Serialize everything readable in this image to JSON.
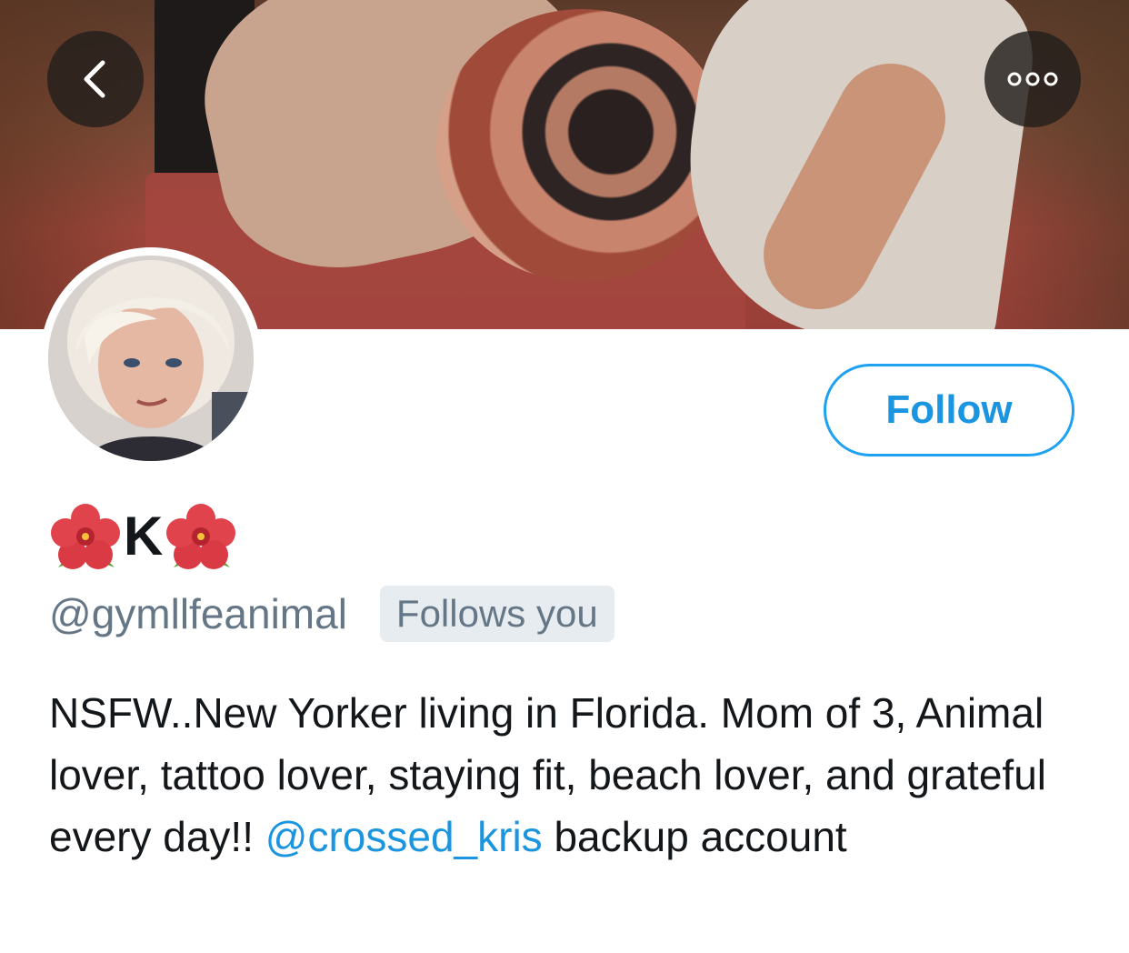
{
  "header": {
    "back_icon": "chevron-left-icon",
    "more_icon": "more-dots-icon"
  },
  "profile": {
    "name_prefix_emoji": "hibiscus-icon",
    "name": "K",
    "name_suffix_emoji": "hibiscus-icon",
    "handle": "@gymllfeanimal",
    "follows_you": "Follows you",
    "follow_button": "Follow"
  },
  "bio": {
    "text_before_mention": "NSFW..New Yorker living in Florida. Mom of 3, Animal lover, tattoo lover, staying fit, beach lover, and grateful every day!! ",
    "mention": "@crossed_kris",
    "text_after_mention": " backup account"
  },
  "colors": {
    "accent": "#1da1f2",
    "link": "#1b95e0",
    "secondary_text": "#657786",
    "primary_text": "#14171a",
    "badge_bg": "#e6ecf0"
  }
}
